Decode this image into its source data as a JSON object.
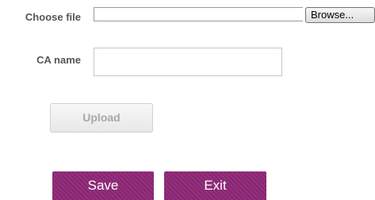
{
  "form": {
    "choose_file_label": "Choose file",
    "file_value": "",
    "browse_label": "Browse...",
    "ca_name_label": "CA name",
    "ca_name_value": "",
    "upload_label": "Upload"
  },
  "actions": {
    "save_label": "Save",
    "exit_label": "Exit"
  },
  "colors": {
    "accent": "#8a2472",
    "label_text": "#555555",
    "disabled_text": "#a8a8a8"
  }
}
